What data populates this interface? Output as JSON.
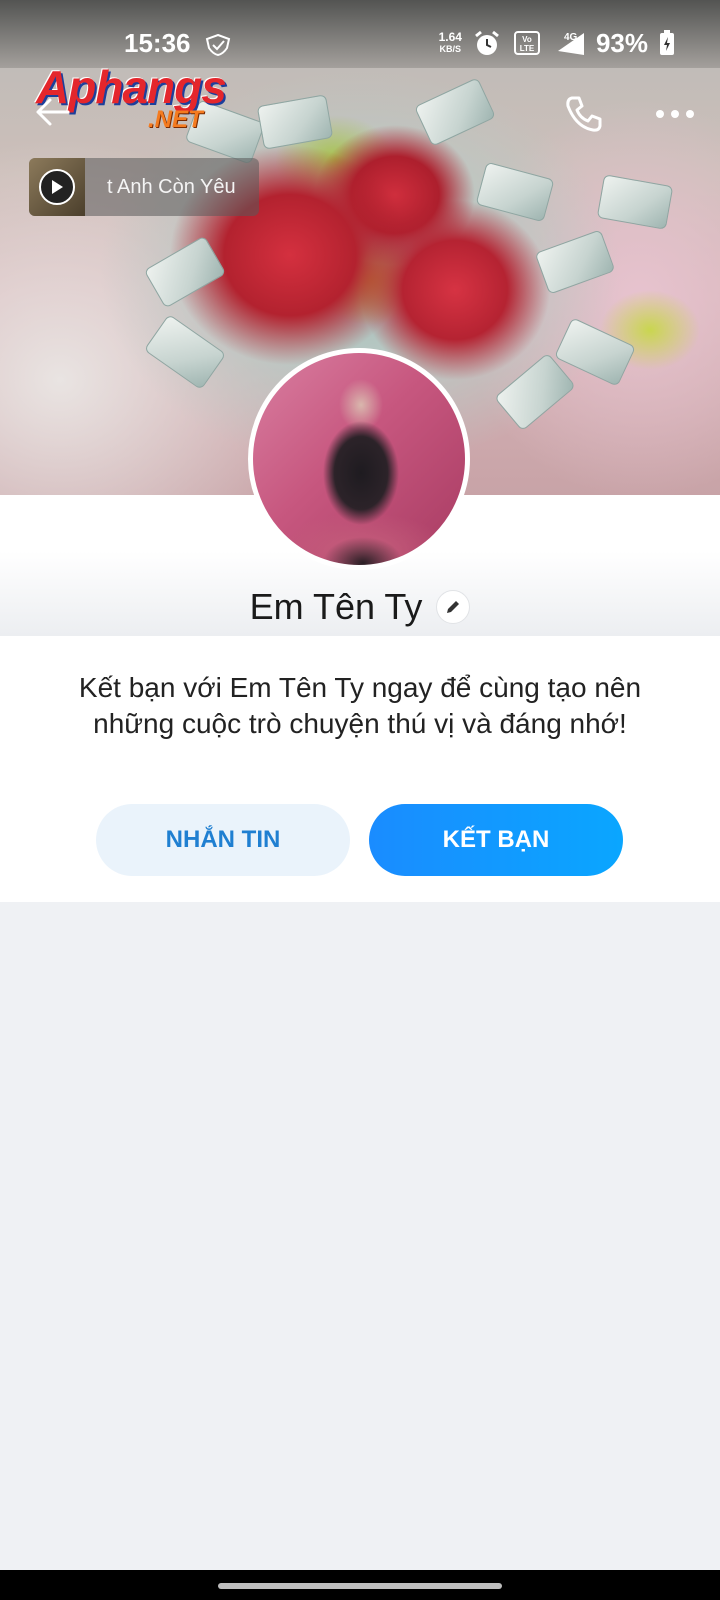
{
  "status_bar": {
    "time": "15:36",
    "speed_value": "1.64",
    "speed_unit": "KB/S",
    "network": "4G",
    "volte": "VoLTE",
    "battery": "93%"
  },
  "watermark": {
    "main": "Aphangs",
    "sub": ".NET"
  },
  "header": {
    "back_icon": "arrow-left-icon",
    "call_icon": "phone-icon",
    "more_icon": "more-horizontal-icon"
  },
  "music": {
    "title": "t Anh Còn Yêu"
  },
  "profile": {
    "name": "Em Tên Ty",
    "invite_text": "Kết bạn với Em Tên Ty ngay để cùng tạo nên những cuộc trò chuyện thú vị và đáng nhớ!",
    "message_button": "NHẮN TIN",
    "add_friend_button": "KẾT BẠN"
  },
  "colors": {
    "primary": "#0a8cff",
    "secondary_bg": "#eaf3fb",
    "page_bg": "#eff1f4"
  }
}
